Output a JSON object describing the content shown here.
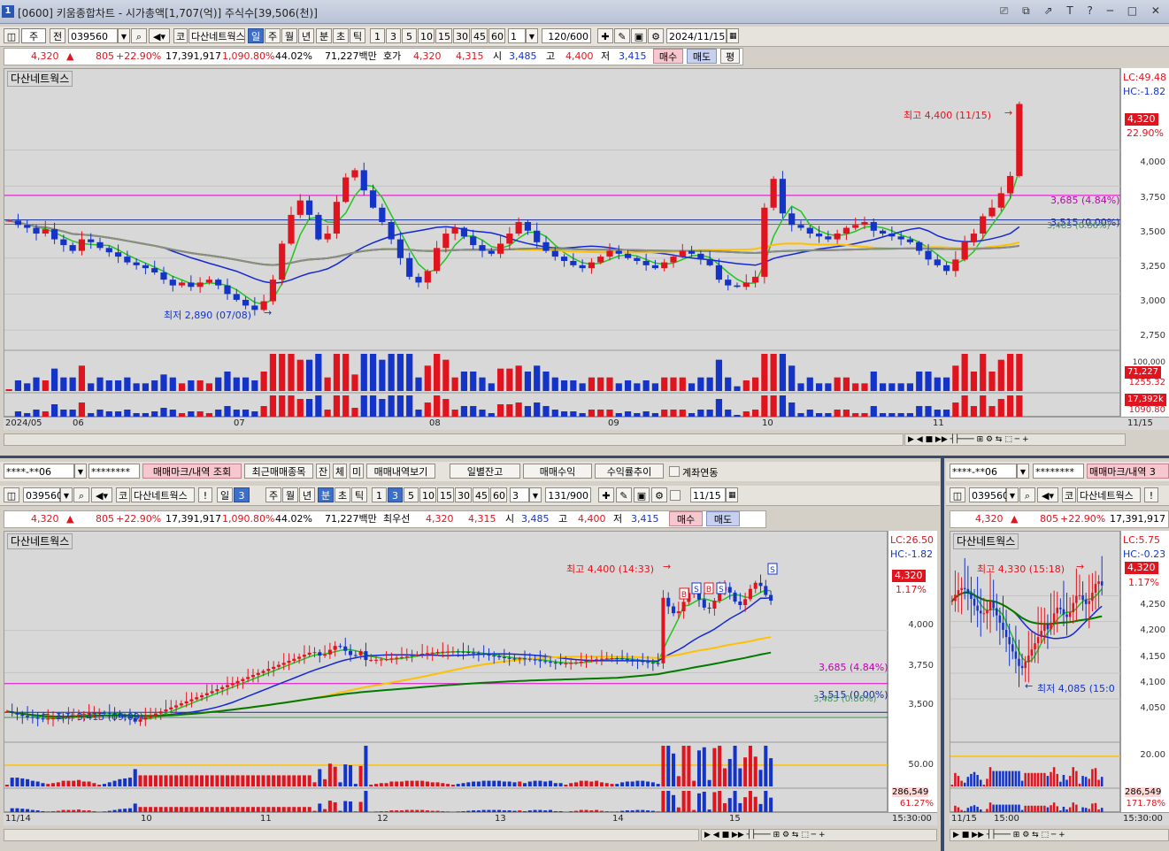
{
  "window": {
    "title": "[0600] 키움종합차트 - 시가총액[1,707(억)] 주식수[39,506(천)]",
    "badge": "1",
    "controls": "⎚ ⧉ ⇗ T ? ─ □ ✕"
  },
  "toolbar_top": {
    "market": "주",
    "prev": "전",
    "code": "039560",
    "code_dropdown": "▼",
    "search_icon": "🔍",
    "sound": "◀▾",
    "kospi": "코",
    "name": "다산네트웍스",
    "periods": [
      "일",
      "주",
      "월",
      "년",
      "분",
      "초",
      "틱"
    ],
    "active_period": "일",
    "numbers": [
      "1",
      "3",
      "5",
      "10",
      "15",
      "30",
      "45",
      "60"
    ],
    "interval": "1",
    "count": "120/600",
    "date": "2024/11/15"
  },
  "quote_top": {
    "price": "4,320",
    "arrow": "▲",
    "change": "805",
    "change_pct": "+22.90%",
    "volume": "17,391,917",
    "volume_pct": "1,090.80%",
    "turnover": "44.02%",
    "amount": "71,227백만",
    "hoga_label": "호가",
    "ask": "4,320",
    "bid": "4,315",
    "open_label": "시",
    "open": "3,485",
    "high_label": "고",
    "high": "4,400",
    "low_label": "저",
    "low": "3,415",
    "buy": "매수",
    "sell": "매도",
    "flat": "평"
  },
  "main_chart": {
    "panel_name": "다산네트웍스",
    "lc": "LC:49.48",
    "hc": "HC:-1.82",
    "price_tag": "4,320",
    "pct_tag": "22.90%",
    "price_ticks": [
      "4,000",
      "3,750",
      "3,500",
      "3,250",
      "3,000",
      "2,750"
    ],
    "high_note": "최고 4,400 (11/15)",
    "low_note": "최저 2,890 (07/08)",
    "line1": "3,685 (4.84%)",
    "line2": "3,515 (0.00%)",
    "line3": "3,485 (0.86%)",
    "vol_ticks": [
      "100,000",
      "71,227",
      "1255.32"
    ],
    "amt_ticks": [
      "17,392k",
      "1090.80"
    ],
    "x_labels": [
      "2024/05",
      "06",
      "07",
      "08",
      "09",
      "10",
      "11",
      "11/15"
    ]
  },
  "chart_data": [
    {
      "type": "candlestick",
      "title": "다산네트웍스",
      "period": "daily",
      "ylim": [
        2750,
        4400
      ],
      "annotations": {
        "high": {
          "value": 4400,
          "date": "11/15"
        },
        "low": {
          "value": 2890,
          "date": "07/08"
        },
        "hlines": [
          3685,
          3515,
          3485
        ]
      },
      "last": {
        "close": 4320,
        "change_pct": 22.9
      },
      "closes": [
        3510,
        3480,
        3460,
        3420,
        3450,
        3380,
        3340,
        3300,
        3380,
        3360,
        3320,
        3290,
        3260,
        3220,
        3200,
        3180,
        3150,
        3100,
        3060,
        3080,
        3050,
        3080,
        3100,
        3060,
        3000,
        2960,
        2920,
        2890,
        2950,
        3100,
        3350,
        3550,
        3650,
        3550,
        3380,
        3420,
        3640,
        3810,
        3860,
        3720,
        3600,
        3500,
        3380,
        3250,
        3120,
        3080,
        3160,
        3320,
        3420,
        3460,
        3400,
        3340,
        3300,
        3280,
        3350,
        3420,
        3500,
        3440,
        3360,
        3300,
        3260,
        3230,
        3200,
        3180,
        3220,
        3260,
        3300,
        3280,
        3250,
        3230,
        3200,
        3180,
        3220,
        3260,
        3300,
        3280,
        3240,
        3200,
        3100,
        3060,
        3050,
        3080,
        3120,
        3600,
        3800,
        3560,
        3480,
        3460,
        3420,
        3400,
        3380,
        3420,
        3460,
        3480,
        3500,
        3440,
        3420,
        3400,
        3380,
        3360,
        3300,
        3240,
        3200,
        3160,
        3240,
        3360,
        3420,
        3540,
        3600,
        3700,
        3820,
        4320
      ],
      "ma_series": [
        "5",
        "20",
        "60",
        "120"
      ]
    },
    {
      "type": "candlestick",
      "title": "다산네트웍스",
      "period": "3-minute",
      "ylim": [
        3450,
        4400
      ],
      "annotations": {
        "high": {
          "value": 4400,
          "time": "14:33"
        },
        "low": {
          "value": 3415,
          "time": "09:09"
        },
        "hlines": [
          3685,
          3515,
          3485
        ]
      },
      "x_labels": [
        "11/14",
        "10",
        "11",
        "12",
        "13",
        "14",
        "15"
      ],
      "last": {
        "close": 4320,
        "change_pct": 1.17
      }
    },
    {
      "type": "candlestick",
      "title": "다산네트웍스",
      "period": "minute",
      "ylim": [
        4000,
        4350
      ],
      "annotations": {
        "high": {
          "value": 4330,
          "time": "15:18"
        },
        "low": {
          "value": 4085,
          "time": "15:0"
        }
      },
      "x_labels": [
        "11/15",
        "15:00"
      ],
      "last": {
        "close": 4320,
        "change_pct": 1.17
      }
    }
  ],
  "bottom_left": {
    "account": "****-**06",
    "password": "********",
    "buttons": [
      "매매마크/내역 조회",
      "최근매매종목",
      "잔",
      "체",
      "미",
      "매매내역보기",
      "일별잔고",
      "매매수익",
      "수익률추이"
    ],
    "checkbox": "계좌연동",
    "code": "039560",
    "kospi": "코",
    "name": "다산네트웍스",
    "exclaim": "!",
    "periods": [
      "일",
      "3",
      "주",
      "월",
      "년",
      "분",
      "초",
      "틱"
    ],
    "numbers": [
      "1",
      "3",
      "5",
      "10",
      "15",
      "30",
      "45",
      "60"
    ],
    "interval": "3",
    "count": "131/900",
    "date": "11/15",
    "quote": {
      "price": "4,320",
      "arrow": "▲",
      "change": "805",
      "change_pct": "+22.90%",
      "volume": "17,391,917",
      "volume_pct": "1,090.80%",
      "turnover": "44.02%",
      "amount": "71,227백만",
      "best_label": "최우선",
      "ask": "4,320",
      "bid": "4,315",
      "open_label": "시",
      "open": "3,485",
      "high_label": "고",
      "high": "4,400",
      "low_label": "저",
      "low": "3,415",
      "buy": "매수",
      "sell": "매도"
    },
    "chart": {
      "panel_name": "다산네트웍스",
      "lc": "LC:26.50",
      "hc": "HC:-1.82",
      "price_tag": "4,320",
      "pct_tag": "1.17%",
      "price_ticks": [
        "4,000",
        "3,750",
        "3,500"
      ],
      "high_note": "최고 4,400 (14:33)",
      "low_note": "최저 3,415 (09:09)",
      "line1": "3,685 (4.84%)",
      "line2": "3,515 (0.00%)",
      "line3": "3,485 (0.86%)",
      "vol_ticks": [
        "50.00"
      ],
      "amt_ticks": [
        "286,549",
        "61.27%"
      ],
      "x_labels": [
        "11/14",
        "10",
        "11",
        "12",
        "13",
        "14",
        "15",
        "15:30:00"
      ],
      "marks": [
        "B",
        "S",
        "B",
        "S",
        "S"
      ]
    }
  },
  "bottom_right": {
    "account": "****-**06",
    "password": "********",
    "button": "매매마크/내역 3",
    "code": "039560",
    "kospi": "코",
    "name": "다산네트웍스",
    "exclaim": "!",
    "quote": {
      "price": "4,320",
      "arrow": "▲",
      "change": "805",
      "change_pct": "+22.90%",
      "volume": "17,391,917"
    },
    "chart": {
      "panel_name": "다산네트웍스",
      "lc": "LC:5.75",
      "hc": "HC:-0.23",
      "price_tag": "4,320",
      "pct_tag": "1.17%",
      "price_ticks": [
        "4,250",
        "4,200",
        "4,150",
        "4,100",
        "4,050"
      ],
      "high_note": "최고 4,330 (15:18)",
      "low_note": "최저 4,085 (15:0",
      "vol_ticks": [
        "20.00"
      ],
      "amt_ticks": [
        "286,549",
        "171.78%"
      ],
      "x_labels": [
        "11/15",
        "15:00",
        "15:30:00"
      ]
    }
  },
  "colors": {
    "up": "#e0141e",
    "down": "#1434c8",
    "ma5": "#22c422",
    "ma20": "#1428d2",
    "ma60": "#ffc000",
    "ma120": "#007a00",
    "ma240": "#8c8c8c",
    "hline": "#e000c8"
  }
}
